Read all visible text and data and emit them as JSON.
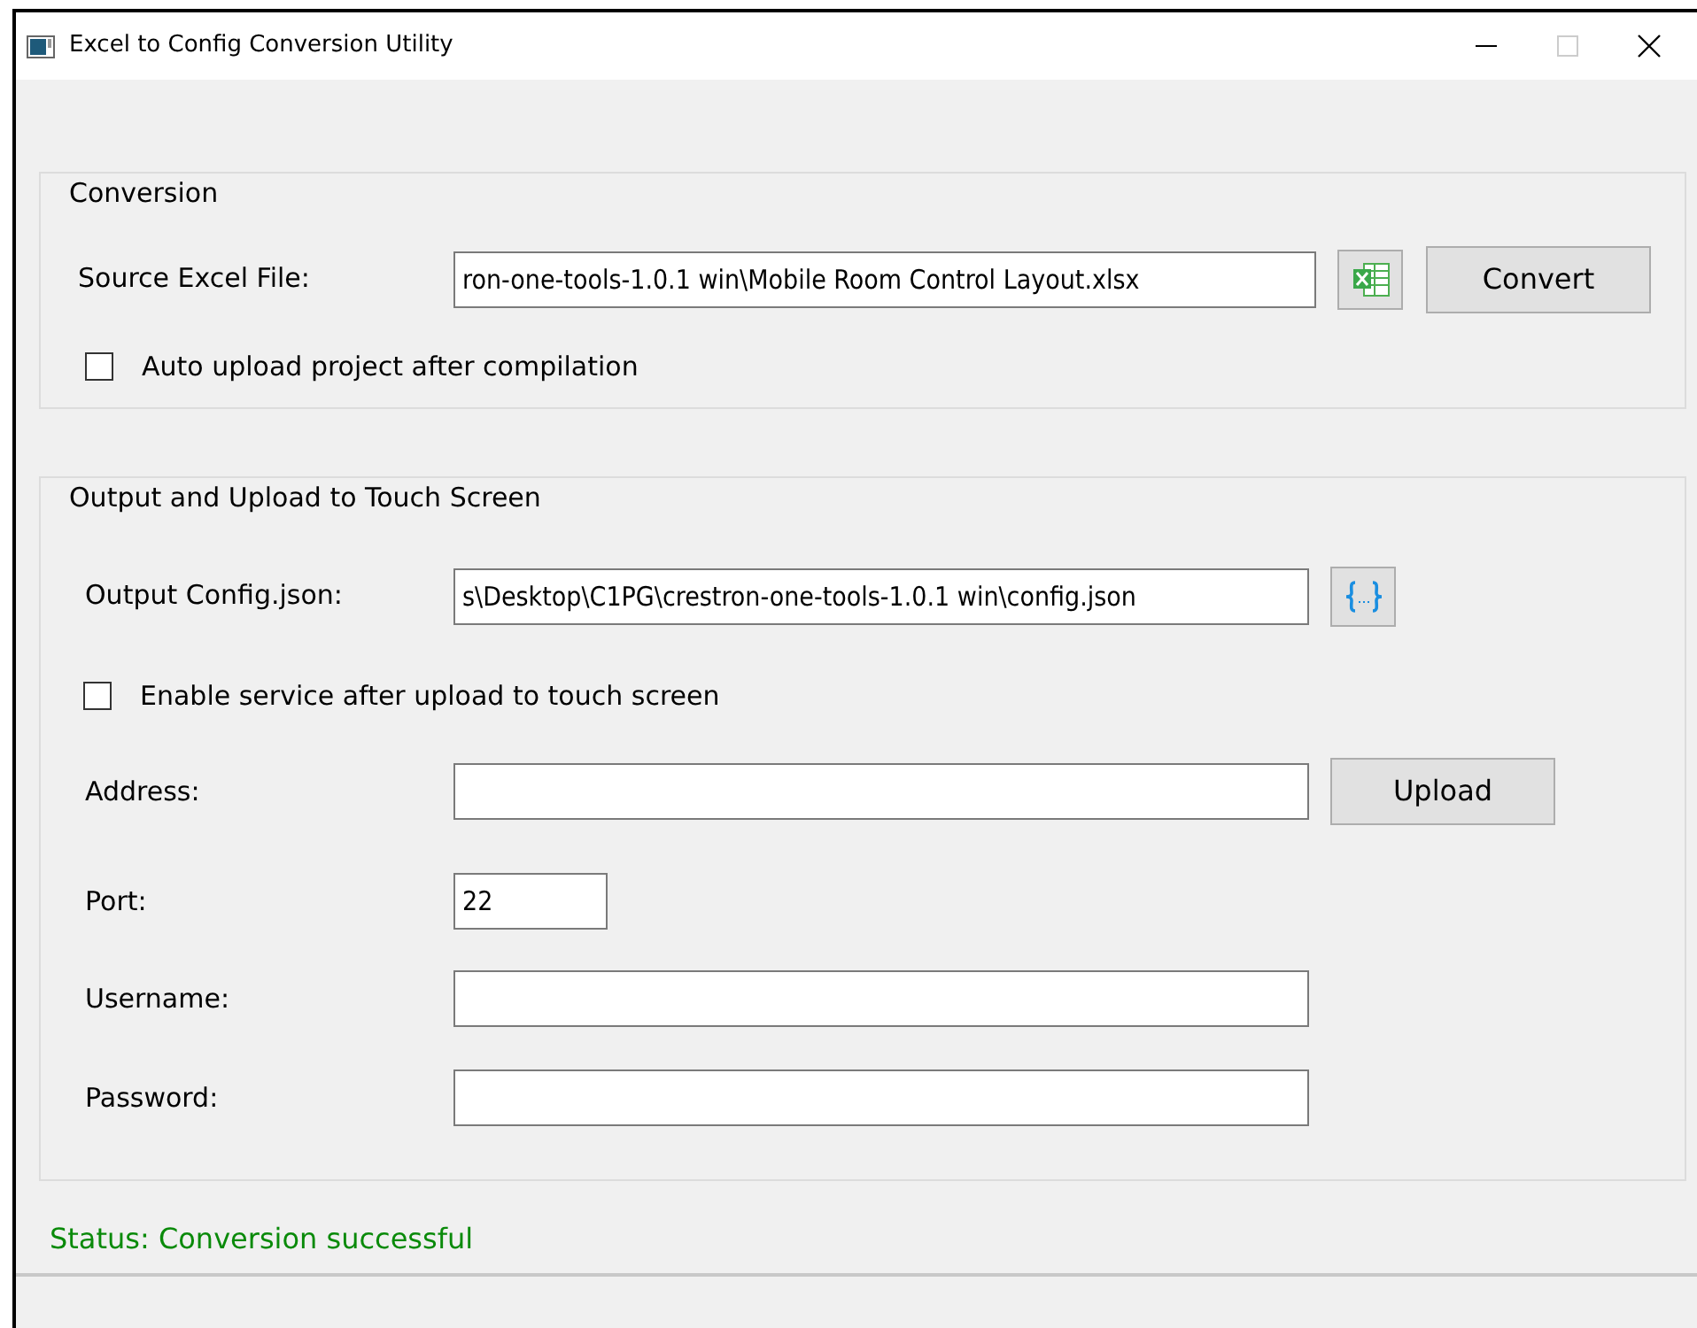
{
  "window": {
    "title": "Excel to Config Conversion Utility"
  },
  "conversion": {
    "title": "Conversion",
    "source_label": "Source Excel File:",
    "source_value": "ron-one-tools-1.0.1 win\\Mobile Room Control Layout.xlsx",
    "convert_button": "Convert",
    "auto_upload": {
      "label": "Auto upload project after compilation",
      "checked": false
    }
  },
  "output": {
    "title": "Output and Upload to Touch Screen",
    "config_label": "Output Config.json:",
    "config_value": "s\\Desktop\\C1PG\\crestron-one-tools-1.0.1 win\\config.json",
    "enable_service": {
      "label": "Enable service after upload to touch screen",
      "checked": false
    },
    "fields": [
      {
        "label": "Address:",
        "kind": "wide",
        "button": "Upload"
      },
      {
        "label": "Port:",
        "value": "22",
        "kind": "short"
      },
      {
        "label": "Username:",
        "kind": "wide"
      },
      {
        "label": "Password:",
        "kind": "wide"
      }
    ]
  },
  "status": "Status: Conversion successful"
}
